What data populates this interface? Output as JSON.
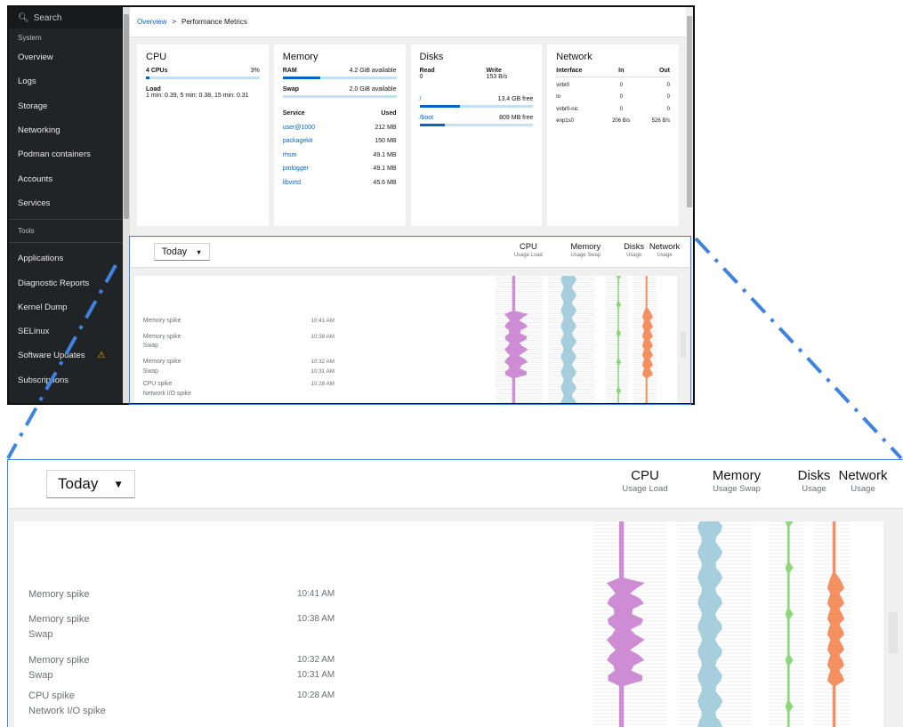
{
  "sidebar": {
    "search_placeholder": "Search",
    "section_system": "System",
    "items": [
      {
        "label": "Overview"
      },
      {
        "label": "Logs"
      },
      {
        "label": "Storage"
      },
      {
        "label": "Networking"
      },
      {
        "label": "Podman containers"
      },
      {
        "label": "Accounts"
      },
      {
        "label": "Services"
      }
    ],
    "section_tools": "Tools",
    "tools": [
      {
        "label": "Applications"
      },
      {
        "label": "Diagnostic Reports"
      },
      {
        "label": "Kernel Dump"
      },
      {
        "label": "SELinux"
      },
      {
        "label": "Software Updates"
      },
      {
        "label": "Subscriptions"
      }
    ]
  },
  "breadcrumb": {
    "root": "Overview",
    "separator": ">",
    "current": "Performance Metrics"
  },
  "cpu": {
    "title": "CPU",
    "count_label": "4 CPUs",
    "usage_pct": "3%",
    "usage_fraction": 0.03,
    "load_label": "Load",
    "load_text": "1 min: 0.39, 5 min: 0.38, 15 min: 0.31"
  },
  "memory": {
    "title": "Memory",
    "ram_label": "RAM",
    "ram_avail": "4.2 GiB available",
    "ram_fraction": 0.33,
    "swap_label": "Swap",
    "swap_avail": "2.0 GiB available",
    "swap_fraction": 0.0,
    "service_header": "Service",
    "used_header": "Used",
    "services": [
      {
        "name": "user@1000",
        "used": "212 MB"
      },
      {
        "name": "packagekit",
        "used": "150 MB"
      },
      {
        "name": "rhsm",
        "used": "49.1 MB"
      },
      {
        "name": "pmlogger",
        "used": "49.1 MB"
      },
      {
        "name": "libvirtd",
        "used": "45.6 MB"
      }
    ]
  },
  "disks": {
    "title": "Disks",
    "read_label": "Read",
    "read_value": "0",
    "write_label": "Write",
    "write_value": "153 B/s",
    "mounts": [
      {
        "path": "/",
        "free": "13.4 GB free",
        "fraction": 0.36
      },
      {
        "path": "/boot",
        "free": "809 MB free",
        "fraction": 0.22
      }
    ]
  },
  "network": {
    "title": "Network",
    "headers": [
      "Interface",
      "In",
      "Out"
    ],
    "rows": [
      [
        "virbr0",
        "0",
        "0"
      ],
      [
        "lo",
        "0",
        "0"
      ],
      [
        "virbr0-nic",
        "0",
        "0"
      ],
      [
        "enp1s0",
        "206 B/s",
        "526 B/s"
      ]
    ]
  },
  "timeline": {
    "range_label": "Today",
    "groups": [
      {
        "title": "CPU",
        "sub": "Usage  Load"
      },
      {
        "title": "Memory",
        "sub": "Usage  Swap"
      },
      {
        "title": "Disks",
        "sub": "Usage"
      },
      {
        "title": "Network",
        "sub": "Usage"
      }
    ],
    "events": [
      {
        "lines": [
          "Memory spike"
        ],
        "times": [
          "10:41 AM"
        ]
      },
      {
        "lines": [
          "Memory spike",
          "Swap"
        ],
        "times": [
          "10:38 AM"
        ]
      },
      {
        "lines": [
          "Memory spike",
          "Swap"
        ],
        "times": [
          "10:32 AM",
          "10:31 AM"
        ]
      },
      {
        "lines": [
          "CPU spike",
          "Network I/O spike"
        ],
        "times": [
          "10:28 AM"
        ]
      }
    ],
    "colors": {
      "cpu": "#c97fd0",
      "memory": "#9cc9d9",
      "disks": "#7ed36a",
      "network": "#f4844f",
      "accent": "#3f83e0"
    }
  }
}
